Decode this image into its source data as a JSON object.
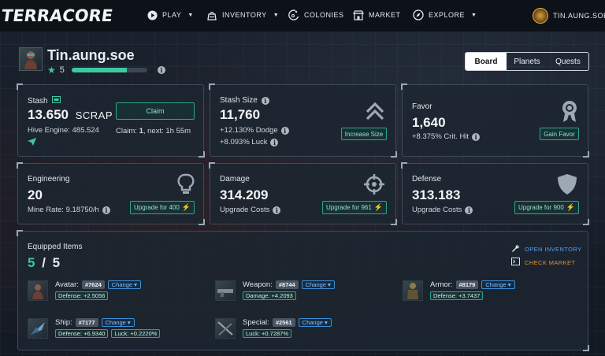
{
  "nav": {
    "logo": "TERRACORE",
    "items": [
      {
        "label": "PLAY",
        "icon": "play-icon",
        "dropdown": true
      },
      {
        "label": "INVENTORY",
        "icon": "inventory-icon",
        "dropdown": true
      },
      {
        "label": "COLONIES",
        "icon": "colonies-icon",
        "dropdown": false
      },
      {
        "label": "MARKET",
        "icon": "market-icon",
        "dropdown": false
      },
      {
        "label": "EXPLORE",
        "icon": "compass-icon",
        "dropdown": true
      }
    ],
    "user": "TIN.AUNG.SOE"
  },
  "profile": {
    "name": "Tin.aung.soe",
    "level": "5",
    "xp_progress": 0.73
  },
  "tabs": [
    "Board",
    "Planets",
    "Quests"
  ],
  "active_tab": "Board",
  "stash": {
    "title": "Stash",
    "value": "13.650",
    "unit": "SCRAP",
    "hive_engine": "Hive Engine: 485.524",
    "claim_button": "Claim",
    "claim_info_prefix": "Claim: ",
    "claim_count": "1",
    "claim_info_next": ", next: 1h 55m"
  },
  "stash_size": {
    "title": "Stash Size",
    "value": "11,760",
    "dodge": "+12.130% Dodge",
    "luck": "+8.093% Luck",
    "button": "Increase Size"
  },
  "favor": {
    "title": "Favor",
    "value": "1,640",
    "crit": "+8.375% Crit. Hit",
    "button": "Gain Favor"
  },
  "engineering": {
    "title": "Engineering",
    "value": "20",
    "mine_rate": "Mine Rate: 9.18750/h",
    "button": "Upgrade for 400"
  },
  "damage": {
    "title": "Damage",
    "value": "314.209",
    "sub": "Upgrade Costs",
    "button": "Upgrade for 961"
  },
  "defense": {
    "title": "Defense",
    "value": "313.183",
    "sub": "Upgrade Costs",
    "button": "Upgrade for 900"
  },
  "equipped": {
    "title": "Equipped Items",
    "current": "5",
    "separator": "/",
    "total": "5",
    "open_inventory": "OPEN INVENTORY",
    "check_market": "CHECK MARKET",
    "change_label": "Change",
    "items": [
      {
        "slot": "Avatar:",
        "id": "#7624",
        "stats": [
          "Defense: +2.5056"
        ]
      },
      {
        "slot": "Weapon:",
        "id": "#8744",
        "stats": [
          "Damage: +4.2093"
        ]
      },
      {
        "slot": "Armor:",
        "id": "#8179",
        "stats": [
          "Defense: +3.7437"
        ]
      },
      {
        "slot": "Ship:",
        "id": "#7177",
        "stats": [
          "Defense: +6.9340",
          "Luck: +0.2220%"
        ]
      },
      {
        "slot": "Special:",
        "id": "#2561",
        "stats": [
          "Luck: +0.7287%"
        ]
      }
    ]
  },
  "colors": {
    "accent": "#3ec8a0",
    "link_blue": "#4fa3ff",
    "market_orange": "#e0913a",
    "background": "#151c26"
  }
}
